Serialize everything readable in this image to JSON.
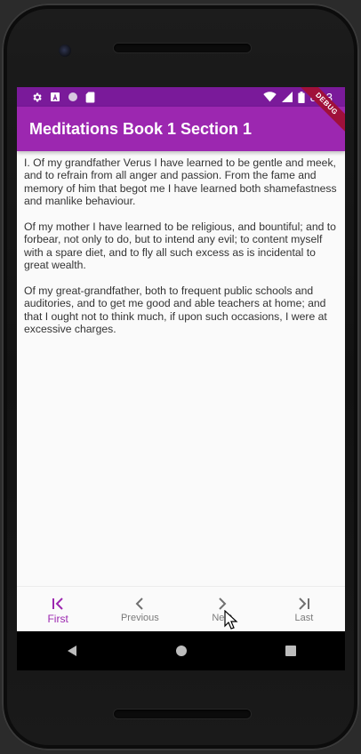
{
  "status_bar": {
    "time": "8:33",
    "left_icons": [
      "gear-icon",
      "a-icon",
      "circle-icon",
      "sd-card-icon"
    ],
    "right_icons": [
      "wifi-icon",
      "signal-icon",
      "battery-icon"
    ],
    "color": "#7a1a9a"
  },
  "app_bar": {
    "title": "Meditations Book 1 Section 1",
    "color": "#9c27b0"
  },
  "debug_banner": "DEBUG",
  "content": {
    "paragraphs": [
      "I. Of my grandfather Verus I have learned to be gentle and meek, and to refrain from all anger and passion. From the fame and memory of him that begot me I have learned both shamefastness and manlike behaviour.",
      "Of my mother I have learned to be religious, and bountiful; and to forbear, not only to do, but to intend any evil; to content myself with a spare diet, and to fly all such excess as is incidental to great wealth.",
      "Of my great-grandfather, both to frequent public schools and auditories, and to get me good and able teachers at home; and that I ought not to think much, if upon such occasions, I were at excessive charges."
    ]
  },
  "bottom_nav": {
    "active_color": "#9c27b0",
    "items": [
      {
        "label": "First",
        "icon": "first-page-icon",
        "active": true
      },
      {
        "label": "Previous",
        "icon": "chevron-left-icon",
        "active": false
      },
      {
        "label": "Next",
        "icon": "chevron-right-icon",
        "active": false
      },
      {
        "label": "Last",
        "icon": "last-page-icon",
        "active": false
      }
    ]
  },
  "system_nav": [
    "back-icon",
    "home-icon",
    "recents-icon"
  ]
}
